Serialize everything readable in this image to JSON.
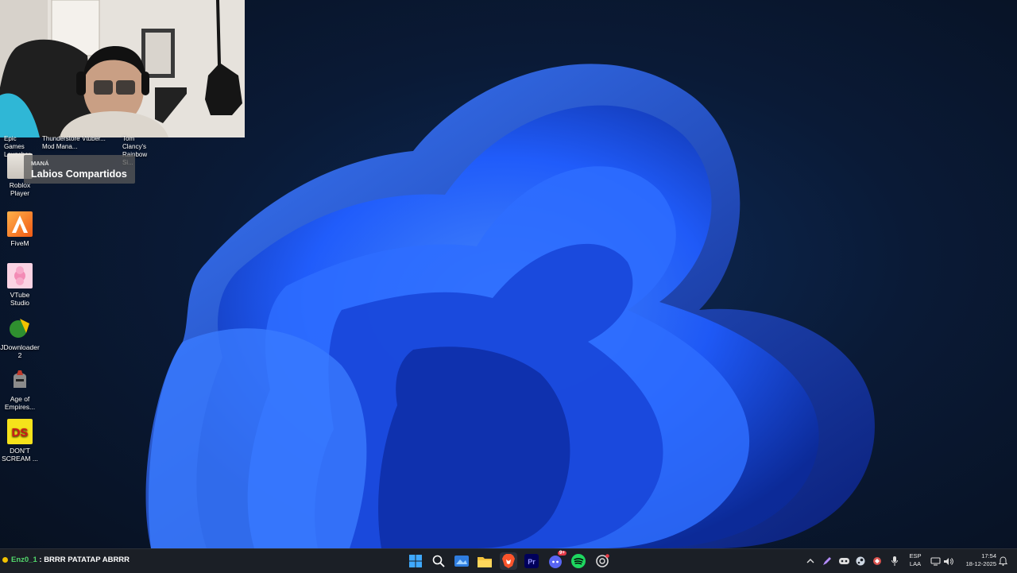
{
  "webcam": {
    "overlay_label": "webcam-overlay"
  },
  "desktop": {
    "top_row": [
      {
        "label": "Epic Games\nLauncher"
      },
      {
        "label": "Thunderstore\nMod Mana..."
      },
      {
        "label": "Vtuber..."
      },
      {
        "label": "Tom Clancy's\nRainbow Si..."
      }
    ],
    "icons": [
      {
        "label": "Roblox Player",
        "icon": "roblox-icon"
      },
      {
        "label": "FiveM",
        "icon": "fivem-icon"
      },
      {
        "label": "VTube Studio",
        "icon": "vtube-studio-icon"
      },
      {
        "label": "JDownloader 2",
        "icon": "jdownloader-icon"
      },
      {
        "label": "Age of Empires...",
        "icon": "age-of-empires-icon"
      },
      {
        "label": "DON'T SCREAM ...",
        "icon": "dont-scream-icon"
      }
    ]
  },
  "music_widget": {
    "artist": "MANÁ",
    "song": "Labios Compartidos"
  },
  "chat": {
    "user": "Enz0_1",
    "message": " : BRRR PATATAP ABRRR"
  },
  "taskbar": {
    "apps": [
      "start-icon",
      "search-icon",
      "widgets-icon",
      "file-explorer-icon",
      "brave-icon",
      "premiere-icon",
      "discord-icon",
      "spotify-icon",
      "chatgpt-icon"
    ],
    "discord_badge": "9+",
    "tray_icons": [
      "chevron-up-icon",
      "pen-icon",
      "gamepad-icon",
      "steam-icon",
      "app-icon",
      "mic-icon"
    ],
    "language_line1": "ESP",
    "language_line2": "LAA",
    "time": "17:54",
    "date": "18-12-2025"
  },
  "colors": {
    "accent_blue": "#1f5cff",
    "taskbar": "#1b1f26",
    "chat_user": "#52d66b"
  }
}
